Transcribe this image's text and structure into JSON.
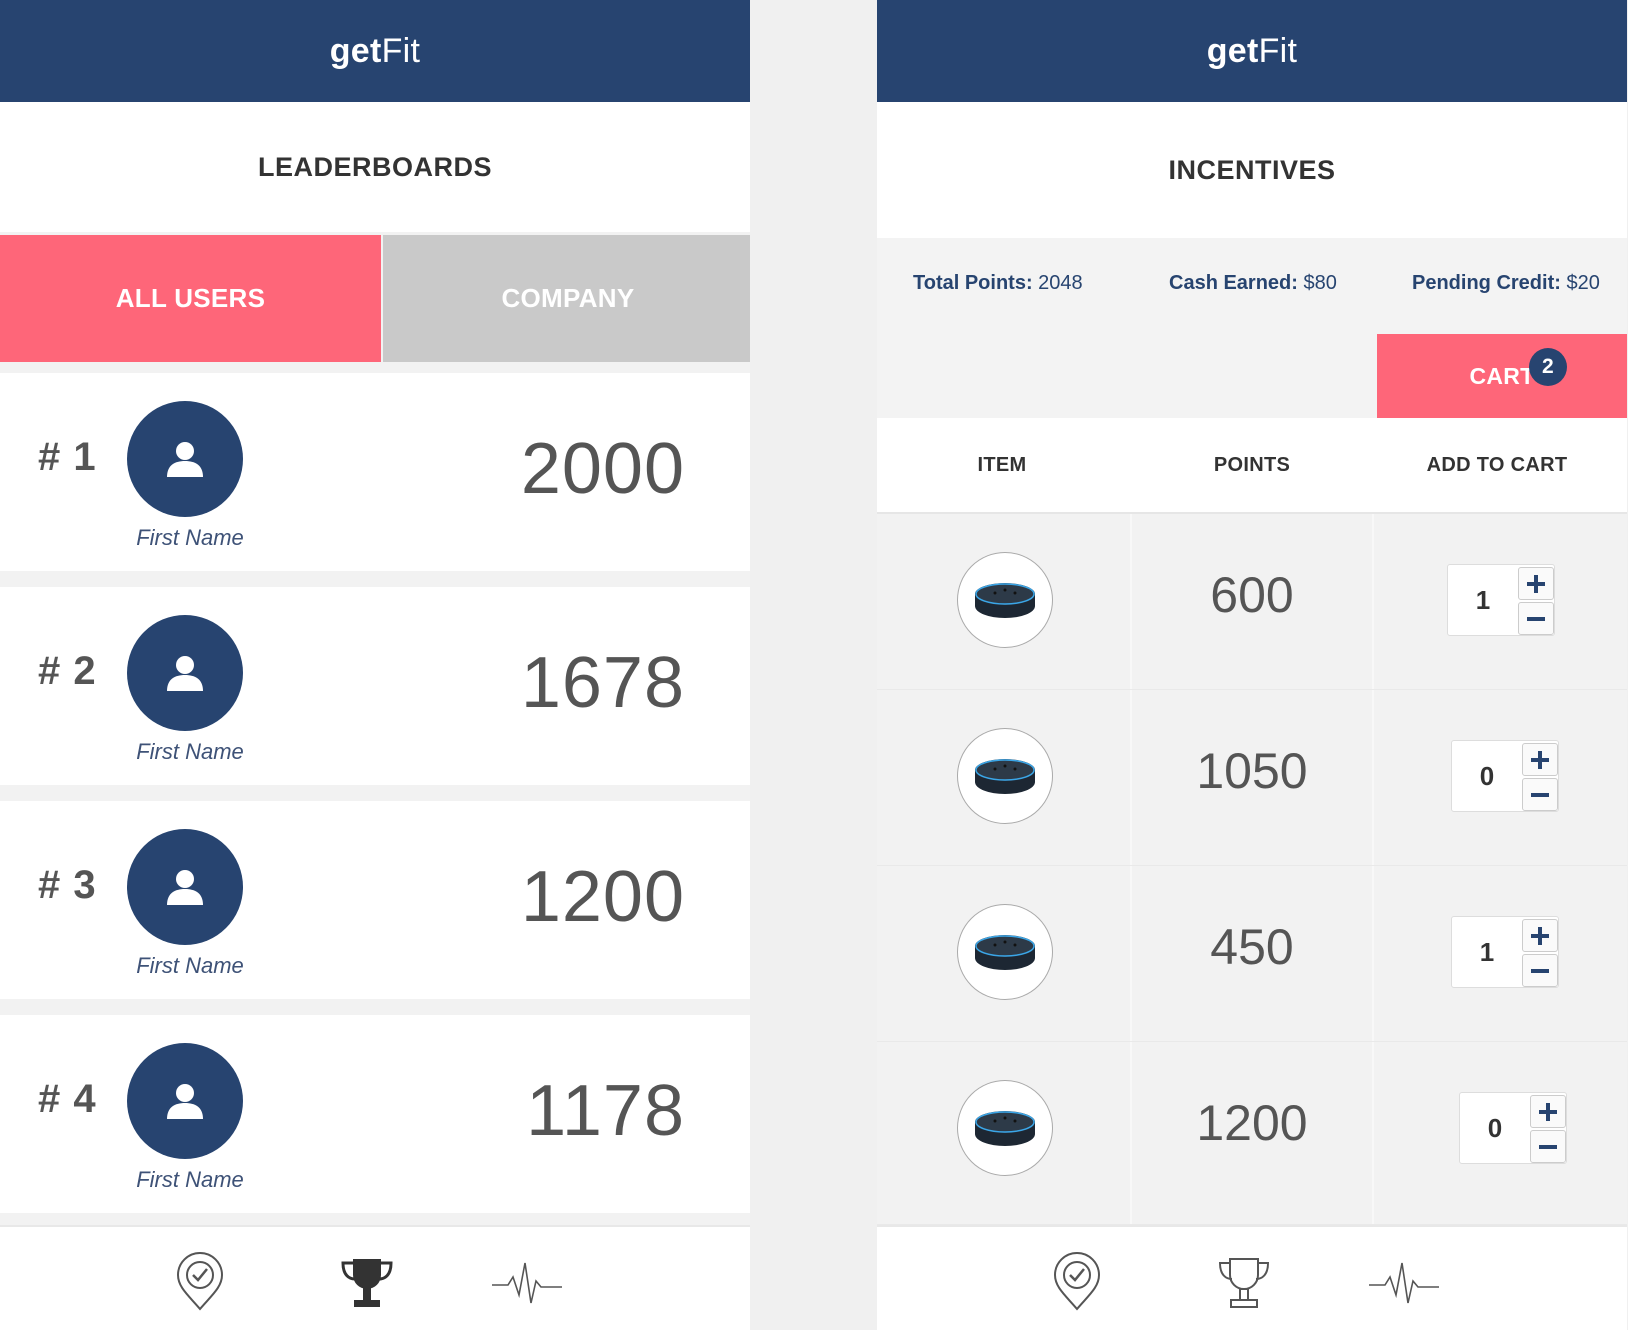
{
  "left": {
    "logo": {
      "bold": "get",
      "light": "Fit"
    },
    "title": "LEADERBOARDS",
    "tabs": [
      {
        "label": "ALL USERS",
        "active": true
      },
      {
        "label": "COMPANY",
        "active": false
      }
    ],
    "rows": [
      {
        "rank": "# 1",
        "name": "First Name",
        "score": "2000"
      },
      {
        "rank": "# 2",
        "name": "First Name",
        "score": "1678"
      },
      {
        "rank": "# 3",
        "name": "First Name",
        "score": "1200"
      },
      {
        "rank": "# 4",
        "name": "First Name",
        "score": "1178"
      }
    ],
    "nav": [
      "checkin-pin-icon",
      "trophy-icon",
      "heartbeat-icon"
    ],
    "nav_active": "trophy-icon"
  },
  "right": {
    "logo": {
      "bold": "get",
      "light": "Fit"
    },
    "title": "INCENTIVES",
    "stats": [
      {
        "key": "Total Points:",
        "value": " 2048"
      },
      {
        "key": "Cash Earned:",
        "value": " $80"
      },
      {
        "key": "Pending Credit:",
        "value": " $20"
      }
    ],
    "cart": {
      "label": "CART",
      "count": "2"
    },
    "table_headers": [
      "ITEM",
      "POINTS",
      "ADD TO CART"
    ],
    "items": [
      {
        "points": "600",
        "qty": "1"
      },
      {
        "points": "1050",
        "qty": "0"
      },
      {
        "points": "450",
        "qty": "1"
      },
      {
        "points": "1200",
        "qty": "0"
      }
    ],
    "nav": [
      "checkin-pin-icon",
      "trophy-icon",
      "heartbeat-icon"
    ],
    "nav_active": "none"
  },
  "colors": {
    "brand_navy": "#274470",
    "accent_pink": "#fe6679",
    "inactive_gray": "#c9c9c9"
  }
}
